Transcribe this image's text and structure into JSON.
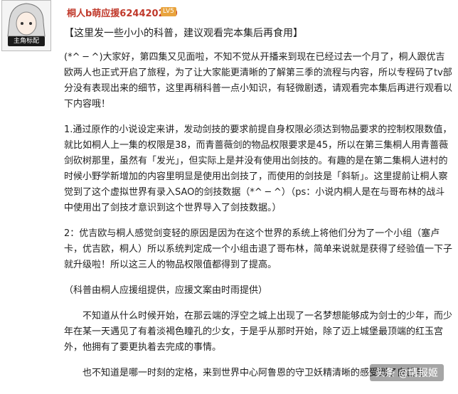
{
  "post": {
    "username": "桐人b萌应援624420200",
    "level": "LV5",
    "avatar_tag": "主角标配",
    "notice": "【这里发一些小小的科普，建议观看完本集后再食用】",
    "paragraphs": [
      "(*^ ─ ^)大家好，第四集又见面啦，不知不觉从开播来到现在已经过去一个月了，桐人跟优吉欧两人也正式开启了旅程，为了让大家能更清晰的了解第三季的流程与内容，所以专程码了tv部分没有表现出来的细节，这里再稍科普一点小知识，有轻微剧透，请观看完本集后再进行观看以下内容哦！",
      "1.通过原作的小说设定来讲，发动剑技的要求前提自身权限必须达到物品要求的控制权限数值，就比如桐人上一集的权限是38，而青蔷薇剑的物品权限要求是45，所以在第三集桐人用青蔷薇剑砍树那里，虽然有「发光」，但实际上是并没有使用出剑技的。有趣的是在第二集桐人进村的时候小野学新增加的内容里明显是使用出剑技了，而使用的剑技是「斜斩」。这里提前让桐人察觉到了这个虚拟世界有录入SAO的剑技数据（*^ ─ ^）（ps：小说内桐人是在与哥布林的战斗中使用出了剑技才意识到这个世界导入了剑技数据。）",
      "2：优吉欧与桐人感觉剑变轻的原因是因为在这个世界的系统上将他们分为了一个小组（塞卢卡，优吉欧，桐人）所以系统判定成一个小组击退了哥布林，简单来说就是获得了经验值一下子就升级啦！所以这三人的物品权限值都得到了提高。",
      "（科普由桐人应援组提供，应援文案由时雨提供）",
      "不知道从什么时候开始，在那云端的浮空之城上出现了一名梦想能够成为剑士的少年，而少年在某一天遇见了有着淡褐色瞳孔的少女，于是乎从那时开始，除了迈上城堡最顶端的红玉宫外，他拥有了要更执着去完成的事情。",
      "也不知道是哪一时刻的定格，来到世界中心阿鲁恩的守卫妖精清晰的感受到了自己与"
    ]
  },
  "watermark": "头条 @情报姬"
}
